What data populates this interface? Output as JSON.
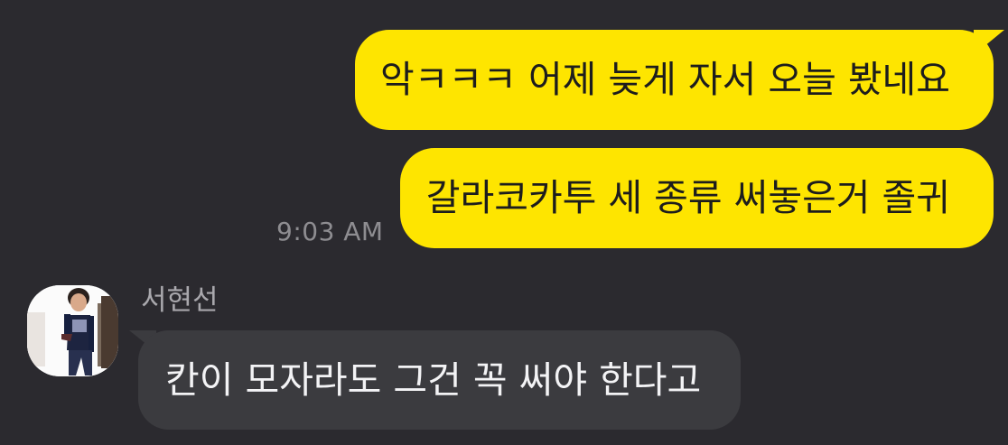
{
  "messages": {
    "outgoing": [
      {
        "text": "악ㅋㅋㅋ 어제 늦게 자서 오늘 봤네요"
      },
      {
        "text": "갈라코카투 세 종류 써놓은거 졸귀"
      }
    ],
    "outgoing_time": "9:03 AM",
    "incoming": {
      "sender": "서현선",
      "text": "칸이 모자라도 그건 꼭 써야 한다고",
      "avatar_icon": "profile-photo-icon"
    }
  },
  "colors": {
    "background": "#2b2a2f",
    "outgoing_bubble": "#fee500",
    "incoming_bubble": "#3b3b3f",
    "timestamp": "#8e8d91",
    "sender_name": "#a9a8ad"
  }
}
